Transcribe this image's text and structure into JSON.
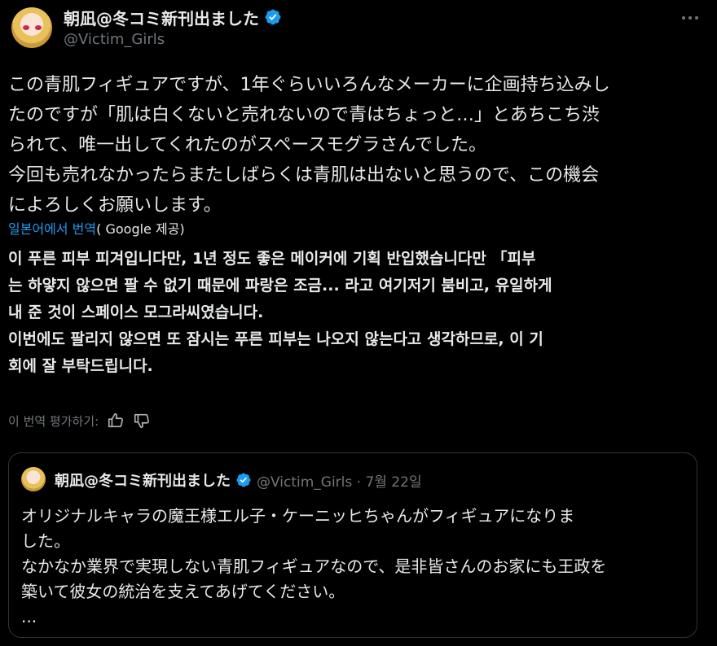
{
  "tweet": {
    "author_name": "朝凪@冬コミ新刊出ました",
    "author_handle": "@Victim_Girls",
    "original_text": "この青肌フィギュアですが、1年ぐらいいろんなメーカーに企画持ち込みし\nたのですが「肌は白くないと売れないので青はちょっと…」とあちこち渋\nられて、唯一出してくれたのがスペースモグラさんでした。\n今回も売れなかったらまたしばらくは青肌は出ないと思うので、この機会\nによろしくお願いします。",
    "translated_label": "일본어에서 번역",
    "translated_provider": "( Google 제공)",
    "translation_text": "이 푸른 피부 피겨입니다만, 1년 정도 좋은 메이커에 기획 반입했습니다만 「피부\n는 하얗지 않으면 팔 수 없기 때문에 파랑은 조금... 라고 여기저기 붐비고, 유일하게\n내 준 것이 스페이스 모그라씨였습니다.\n이번에도 팔리지 않으면 또 잠시는 푸른 피부는 나오지 않는다고 생각하므로, 이 기\n회에 잘 부탁드립니다.",
    "rate_label": "이 번역 평가하기:"
  },
  "quoted": {
    "author_name": "朝凪@冬コミ新刊出ました",
    "meta": "@Victim_Girls · 7월 22일",
    "text": "オリジナルキャラの魔王様エル子・ケーニッヒちゃんがフィギュアになりま\nした。\nなかなか業界で実現しない青肌フィギュアなので、是非皆さんのお家にも王政を\n築いて彼女の統治を支えてあげてください。\n..."
  },
  "icons": {
    "verified": "verified-badge-icon",
    "more": "more-horizontal-icon",
    "thumbs_up": "thumbs-up-icon",
    "thumbs_down": "thumbs-down-icon"
  },
  "colors": {
    "background": "#000000",
    "text": "#e7e9ea",
    "muted": "#71767b",
    "accent": "#1d9bf0",
    "border": "#2f3336"
  }
}
